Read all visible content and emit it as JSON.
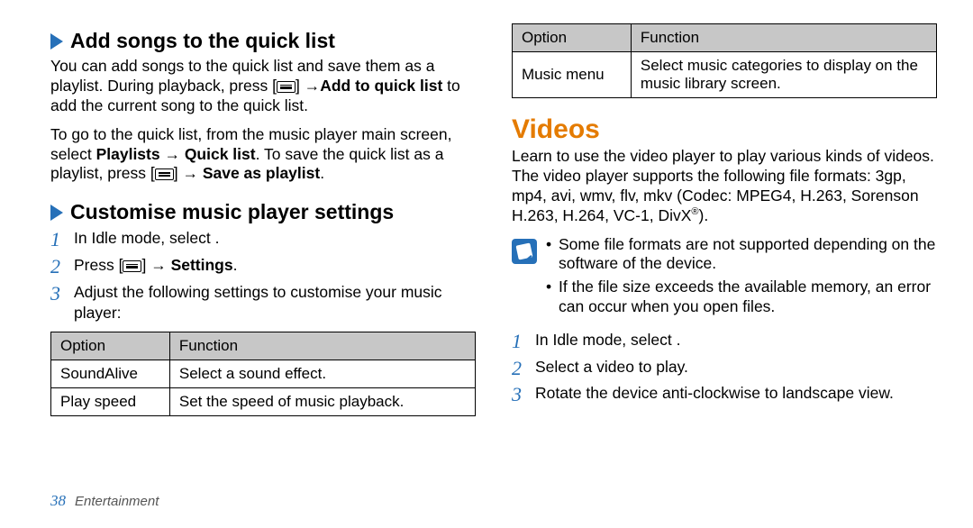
{
  "left": {
    "h1": "Add songs to the quick list",
    "p1a": "You can add songs to the quick list and save them as a playlist. During playback, press [",
    "p1b": "] →",
    "p1c": "Add to quick list",
    "p1d": " to add the current song to the quick list.",
    "p2a": "To go to the quick list, from the music player main screen, select ",
    "p2b": "Playlists → Quick list",
    "p2c": ". To save the quick list as a playlist, press [",
    "p2d": "] → ",
    "p2e": "Save as playlist",
    "p2f": ".",
    "h2": "Customise music player settings",
    "s1": "In Idle mode, select        .",
    "s2a": "Press [",
    "s2b": "] → ",
    "s2c": "Settings",
    "s2d": ".",
    "s3": "Adjust the following settings to customise your music player:",
    "th1": "Option",
    "th2": "Function",
    "r1c1": "SoundAlive",
    "r1c2": "Select a sound effect.",
    "r2c1": "Play speed",
    "r2c2": "Set the speed of music playback."
  },
  "right": {
    "th1": "Option",
    "th2": "Function",
    "r1c1": "Music menu",
    "r1c2": "Select music categories to display on the music library screen.",
    "title": "Videos",
    "p1": "Learn to use the video player to play various kinds of videos. The video player supports the following file formats: 3gp, mp4, avi, wmv, flv, mkv (Codec: MPEG4, H.263, Sorenson H.263, H.264, VC-1, DivX",
    "p1end": ").",
    "n1": "Some file formats are not supported depending on the software of the device.",
    "n2": "If the file size exceeds the available memory, an error can occur when you open files.",
    "s1": "In Idle mode, select        .",
    "s2": "Select a video to play.",
    "s3": "Rotate the device anti-clockwise to landscape view."
  },
  "footer": {
    "page": "38",
    "section": "Entertainment"
  }
}
